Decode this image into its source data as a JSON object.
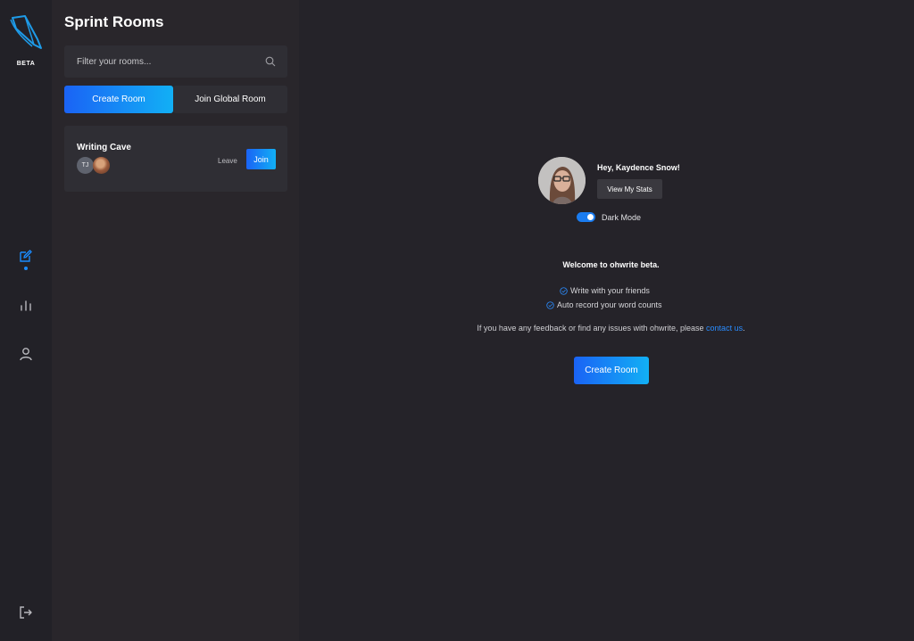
{
  "app": {
    "badge": "BETA"
  },
  "sidebar": {
    "icons": [
      "edit-icon",
      "stats-icon",
      "profile-icon",
      "logout-icon"
    ],
    "accent": "#1a8cff"
  },
  "rooms_panel": {
    "title": "Sprint Rooms",
    "filter_placeholder": "Filter your rooms...",
    "create_label": "Create Room",
    "join_global_label": "Join Global Room",
    "rooms": [
      {
        "name": "Writing Cave",
        "member_initials": "TJ",
        "leave_label": "Leave",
        "join_label": "Join"
      }
    ]
  },
  "main": {
    "greeting": "Hey, Kaydence Snow!",
    "stats_label": "View My Stats",
    "dark_mode_label": "Dark Mode",
    "dark_mode_on": true,
    "welcome": "Welcome to ohwrite beta.",
    "features": [
      "Write with your friends",
      "Auto record your word counts"
    ],
    "feedback_prefix": "If you have any feedback or find any issues with ohwrite, please ",
    "feedback_link": "contact us",
    "feedback_suffix": ".",
    "create_label": "Create Room"
  }
}
